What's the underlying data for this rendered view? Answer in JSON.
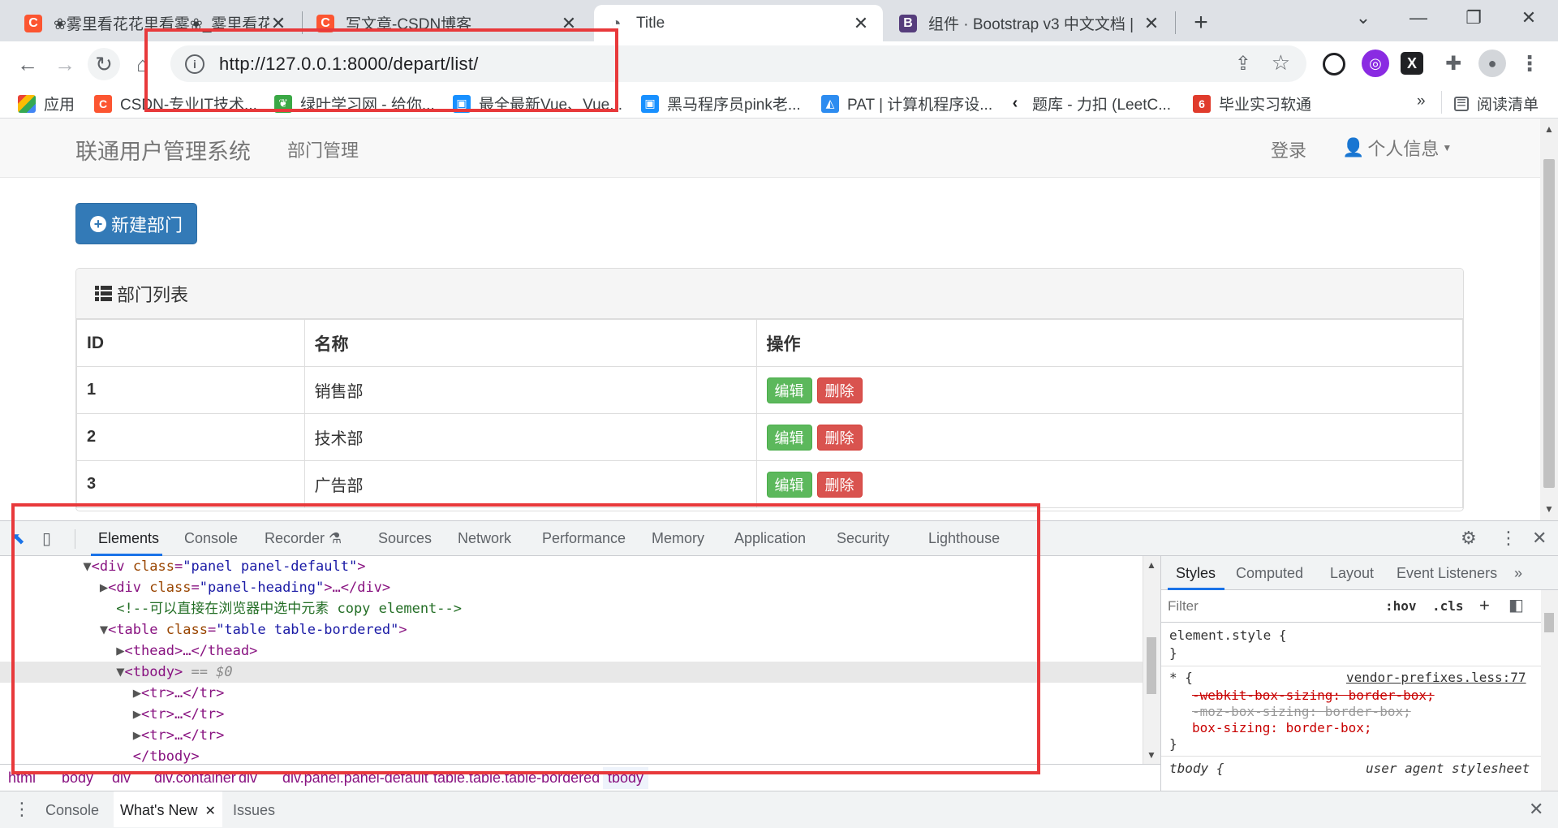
{
  "browser": {
    "tabs": [
      {
        "title": "❀雾里看花花里看雾❀_雾里看花",
        "favicon": "C",
        "color": "#fc5531"
      },
      {
        "title": "写文章-CSDN博客",
        "favicon": "C",
        "color": "#fc5531"
      },
      {
        "title": "Title",
        "favicon": "◔",
        "color": "#5f6368"
      },
      {
        "title": "组件 · Bootstrap v3 中文文档 |",
        "favicon": "B",
        "color": "#563d7c"
      }
    ],
    "new_tab": "+",
    "url": "http://127.0.0.1:8000/depart/list/",
    "bookmarks": [
      "应用",
      "CSDN-专业IT技术...",
      "绿叶学习网 - 给你...",
      "最全最新Vue、Vue...",
      "黑马程序员pink老...",
      "PAT | 计算机程序设...",
      "题库 - 力扣 (LeetC...",
      "毕业实习软通"
    ],
    "bookmarks_more": "»",
    "reading_list": "阅读清单",
    "accent": "#1a73e8"
  },
  "page": {
    "brand": "联通用户管理系统",
    "nav_dept": "部门管理",
    "nav_login": "登录",
    "nav_user": "个人信息",
    "new_button": "新建部门",
    "panel_title": "部门列表",
    "table": {
      "headers": [
        "ID",
        "名称",
        "操作"
      ],
      "rows": [
        {
          "id": "1",
          "name": "销售部"
        },
        {
          "id": "2",
          "name": "技术部"
        },
        {
          "id": "3",
          "name": "广告部"
        }
      ],
      "edit_label": "编辑",
      "delete_label": "删除"
    },
    "colors": {
      "primary": "#337ab7",
      "success": "#5cb85c",
      "danger": "#d9534f",
      "highlight": "#e8393b"
    }
  },
  "devtools": {
    "tabs": [
      "Elements",
      "Console",
      "Recorder",
      "Sources",
      "Network",
      "Performance",
      "Memory",
      "Application",
      "Security",
      "Lighthouse"
    ],
    "dom": [
      {
        "pre": "▼",
        "tag": "div",
        "attr": "class",
        "val": "panel panel-default",
        "post": "",
        "indent": 5
      },
      {
        "pre": "▶",
        "tag": "div",
        "attr": "class",
        "val": "panel-heading",
        "post": "…</div>",
        "indent": 6
      },
      {
        "comment": "<!--可以直接在浏览器中选中元素 copy element-->",
        "indent": 7
      },
      {
        "pre": "▼",
        "tag": "table",
        "attr": "class",
        "val": "table table-bordered",
        "post": "",
        "indent": 6
      },
      {
        "pre": "▶",
        "tag": "thead",
        "post": "…</thead>",
        "indent": 7
      },
      {
        "pre": "▼",
        "tag": "tbody",
        "post": "",
        "eq": " == $0",
        "indent": 7,
        "selected": true
      },
      {
        "pre": "▶",
        "tag": "tr",
        "post": "…</tr>",
        "indent": 8
      },
      {
        "pre": "▶",
        "tag": "tr",
        "post": "…</tr>",
        "indent": 8
      },
      {
        "pre": "▶",
        "tag": "tr",
        "post": "…</tr>",
        "indent": 8
      },
      {
        "close": "</tbody>",
        "indent": 8
      }
    ],
    "breadcrumbs": [
      "html",
      "body",
      "div",
      "div.container",
      "div",
      "div.panel.panel-default",
      "table.table.table-bordered",
      "tbody"
    ],
    "styles_tabs": [
      "Styles",
      "Computed",
      "Layout",
      "Event Listeners",
      "»"
    ],
    "filter_placeholder": "Filter",
    "hov": ":hov",
    "cls": ".cls",
    "rules": {
      "element_style": "element.style {",
      "close": "}",
      "star": "* {",
      "star_src": "vendor-prefixes.less:77",
      "p1": "-webkit-box-sizing: border-box;",
      "p2": "-moz-box-sizing: border-box;",
      "p3": "box-sizing: border-box;",
      "tbody": "tbody {",
      "tbody_src": "user agent stylesheet"
    },
    "drawer": [
      "Console",
      "What's New",
      "Issues"
    ]
  }
}
